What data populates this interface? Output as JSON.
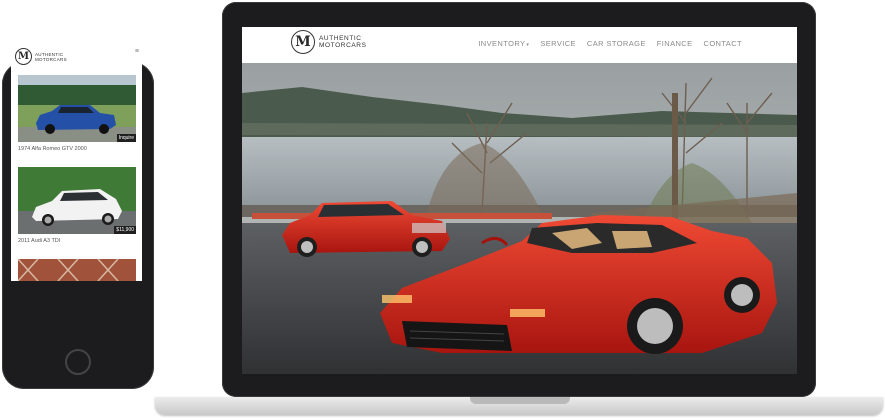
{
  "brand": {
    "mark": "M",
    "line1": "AUTHENTIC",
    "line2": "MOTORCARS"
  },
  "nav": [
    {
      "label": "INVENTORY",
      "caret": "▾"
    },
    {
      "label": "SERVICE"
    },
    {
      "label": "CAR STORAGE"
    },
    {
      "label": "FINANCE"
    },
    {
      "label": "CONTACT"
    }
  ],
  "mobile": {
    "menu_icon": "hamburger-icon",
    "menu_glyph": "≡",
    "listings": [
      {
        "caption": "1974 Alfa Romeo GTV 2000",
        "tag": "Inquire"
      },
      {
        "caption": "2011 Audi A3 TDI",
        "tag": "$11,900"
      }
    ]
  },
  "colors": {
    "device": "#1c1c1e",
    "ferrari_red": "#d9281e",
    "nav_text": "#8a8a8a"
  }
}
